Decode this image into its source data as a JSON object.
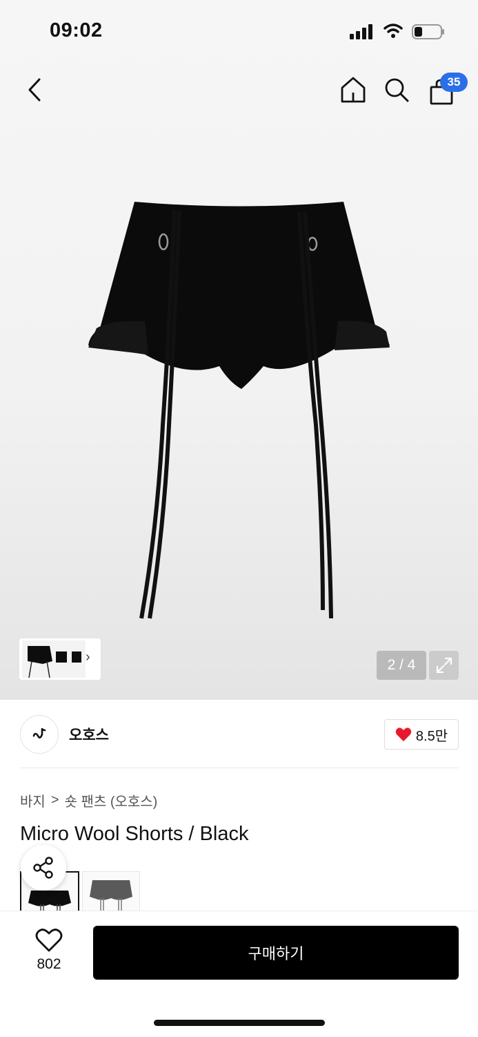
{
  "status_bar": {
    "time": "09:02"
  },
  "header": {
    "cart_count": "35"
  },
  "gallery": {
    "page_indicator": "2 / 4"
  },
  "brand": {
    "name": "오호스",
    "like_count": "8.5만"
  },
  "breadcrumb": {
    "category": "바지",
    "separator": ">",
    "subcategory": "숏 팬츠 (오호스)"
  },
  "product": {
    "title": "Micro Wool Shorts / Black"
  },
  "bottom_bar": {
    "wish_count": "802",
    "buy_label": "구매하기"
  },
  "colors": {
    "accent_badge": "#2b6fe8",
    "heart": "#e8192c",
    "primary_button": "#000000"
  },
  "icons": [
    "back-icon",
    "home-icon",
    "search-icon",
    "bag-icon",
    "expand-icon",
    "share-icon",
    "heart-icon"
  ]
}
